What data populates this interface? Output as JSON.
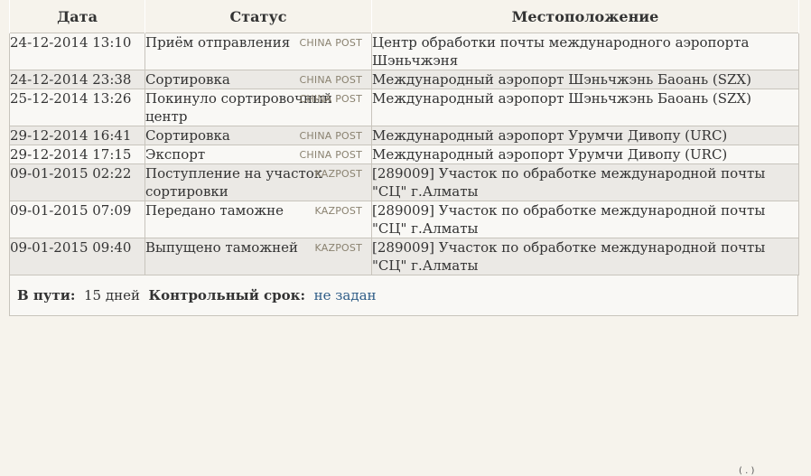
{
  "headers": {
    "date": "Дата",
    "status": "Статус",
    "location": "Местоположение"
  },
  "rows": [
    {
      "date": "24-12-2014 13:10",
      "status": "Приём отправления",
      "carrier": "CHINA POST",
      "location": "Центр обработки почты международного аэропорта Шэньчжэня"
    },
    {
      "date": "24-12-2014 23:38",
      "status": "Сортировка",
      "carrier": "CHINA POST",
      "location": "Международный аэропорт Шэньчжэнь Баоань (SZX)"
    },
    {
      "date": "25-12-2014 13:26",
      "status": "Покинуло сортировочный центр",
      "carrier": "CHINA POST",
      "location": "Международный аэропорт Шэньчжэнь Баоань (SZX)"
    },
    {
      "date": "29-12-2014 16:41",
      "status": "Сортировка",
      "carrier": "CHINA POST",
      "location": "Международный аэропорт Урумчи Дивопу (URC)"
    },
    {
      "date": "29-12-2014 17:15",
      "status": "Экспорт",
      "carrier": "CHINA POST",
      "location": "Международный аэропорт Урумчи Дивопу (URC)"
    },
    {
      "date": "09-01-2015 02:22",
      "status": "Поступление на участок сортировки",
      "carrier": "KAZPOST",
      "location": "[289009] Участок по обработке международной почты \"СЦ\" г.Алматы"
    },
    {
      "date": "09-01-2015 07:09",
      "status": "Передано таможне",
      "carrier": "KAZPOST",
      "location": "[289009] Участок по обработке международной почты \"СЦ\" г.Алматы"
    },
    {
      "date": "09-01-2015 09:40",
      "status": "Выпущено таможней",
      "carrier": "KAZPOST",
      "location": "[289009] Участок по обработке международной почты \"СЦ\" г.Алматы"
    }
  ],
  "summary": {
    "in_transit_label": "В пути:",
    "in_transit_value": "15 дней",
    "deadline_label": "Контрольный срок:",
    "deadline_value": "не задан"
  },
  "tail_text": "( . )"
}
